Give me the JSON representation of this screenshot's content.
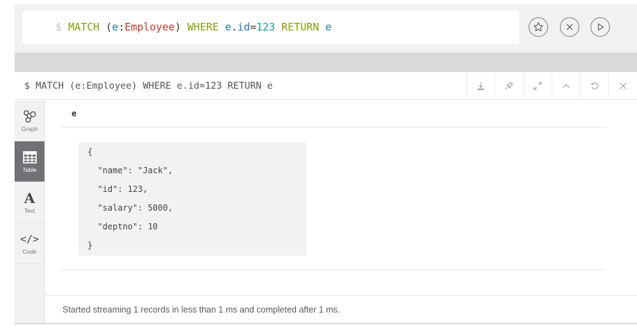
{
  "editor": {
    "prompt": "$",
    "tokens": [
      {
        "text": "MATCH",
        "kind": "kw"
      },
      {
        "text": " ",
        "kind": "punc"
      },
      {
        "text": "(",
        "kind": "punc"
      },
      {
        "text": "e",
        "kind": "var"
      },
      {
        "text": ":",
        "kind": "punc"
      },
      {
        "text": "Employee",
        "kind": "label"
      },
      {
        "text": ")",
        "kind": "punc"
      },
      {
        "text": " ",
        "kind": "punc"
      },
      {
        "text": "WHERE",
        "kind": "kw"
      },
      {
        "text": " ",
        "kind": "punc"
      },
      {
        "text": "e",
        "kind": "var"
      },
      {
        "text": ".",
        "kind": "punc"
      },
      {
        "text": "id",
        "kind": "var"
      },
      {
        "text": "=",
        "kind": "punc"
      },
      {
        "text": "123",
        "kind": "num"
      },
      {
        "text": " ",
        "kind": "punc"
      },
      {
        "text": "RETURN",
        "kind": "kw"
      },
      {
        "text": " ",
        "kind": "punc"
      },
      {
        "text": "e",
        "kind": "var"
      }
    ],
    "buttons": [
      "star-icon",
      "close-icon",
      "play-icon"
    ]
  },
  "frame": {
    "title": "$ MATCH (e:Employee) WHERE e.id=123 RETURN e",
    "tools": [
      "download-icon",
      "pin-icon",
      "expand-icon",
      "collapse-icon",
      "rerun-icon",
      "close-icon"
    ]
  },
  "sidebar": {
    "items": [
      {
        "label": "Graph",
        "icon": "graph-icon",
        "active": false
      },
      {
        "label": "Table",
        "icon": "table-icon",
        "active": true
      },
      {
        "label": "Text",
        "icon": "text-icon",
        "active": false
      },
      {
        "label": "Code",
        "icon": "code-icon",
        "active": false
      }
    ]
  },
  "table": {
    "column": "e",
    "record_lines": [
      "{",
      "  \"name\": \"Jack\",",
      "  \"id\": 123,",
      "  \"salary\": 5000,",
      "  \"deptno\": 10",
      "}"
    ]
  },
  "status": "Started streaming 1 records in less than 1 ms and completed after 1 ms.",
  "colors": {
    "keyword": "#8a9b09",
    "label": "#c0392b",
    "variable": "#2878a8",
    "number": "#1a9f9f",
    "active_tab": "#6f7174"
  }
}
